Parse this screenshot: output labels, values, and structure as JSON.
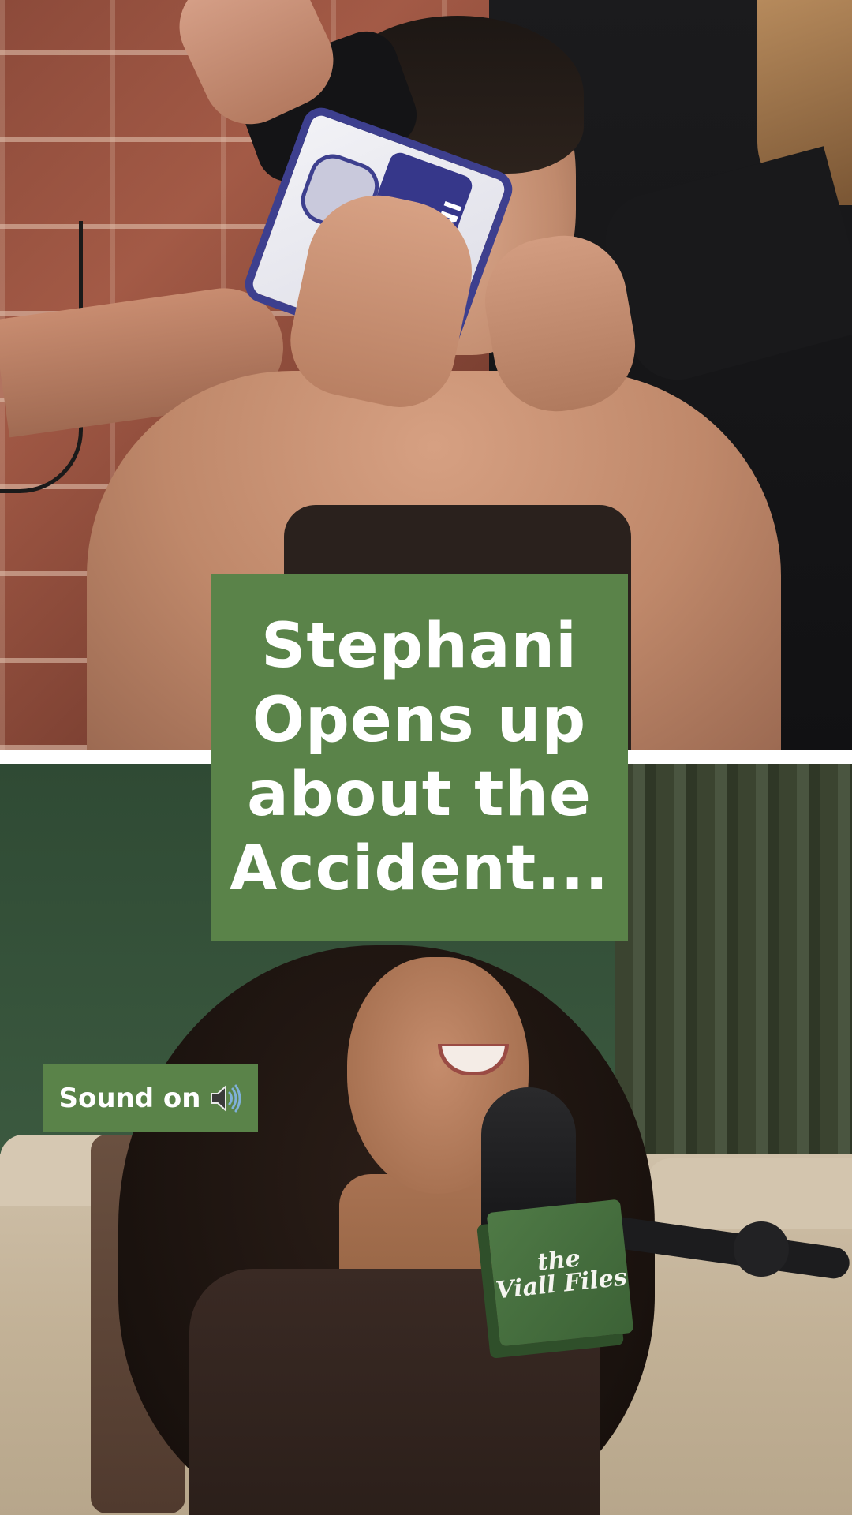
{
  "overlay": {
    "title_lines": [
      "Stephani",
      "Opens up",
      "about the",
      "Accident..."
    ]
  },
  "sound_badge": {
    "label": "Sound on",
    "icon": "speaker-icon"
  },
  "ice_pack": {
    "label": "INSTANT"
  },
  "mic_cube": {
    "logo": "the\nViall Files"
  },
  "colors": {
    "overlay_green": "#5a8349",
    "divider": "#ffffff",
    "ice_pack_blue": "#3d3f8e"
  }
}
